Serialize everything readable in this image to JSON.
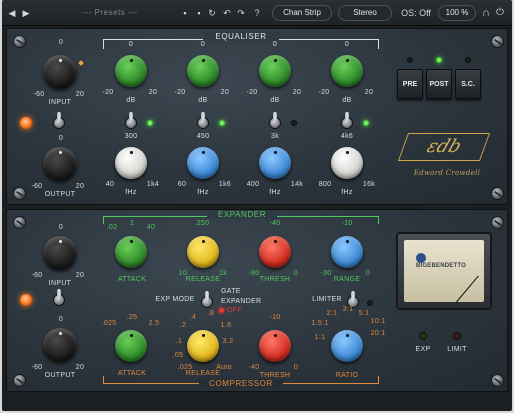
{
  "topbar": {
    "presets_label": "--- Presets ---",
    "chan_strip_label": "Chan Strip",
    "stereo_label": "Stereo",
    "os_label": "OS: Off",
    "zoom_label": "100 %",
    "help_label": "?"
  },
  "eq": {
    "title": "EQUALISER",
    "bands": [
      {
        "gain_top": "0",
        "gain_min": "-20",
        "gain_max": "20",
        "gain_unit": "dB",
        "freq_top": "300",
        "freq_min": "40",
        "freq_max": "1k4",
        "freq_unit": "fHz"
      },
      {
        "gain_top": "0",
        "gain_min": "-20",
        "gain_max": "20",
        "gain_unit": "dB",
        "freq_top": "450",
        "freq_min": "60",
        "freq_max": "1k6",
        "freq_unit": "fHz"
      },
      {
        "gain_top": "0",
        "gain_min": "-20",
        "gain_max": "20",
        "gain_unit": "dB",
        "freq_top": "3k",
        "freq_min": "400",
        "freq_max": "14k",
        "freq_unit": "fHz"
      },
      {
        "gain_top": "0",
        "gain_min": "-20",
        "gain_max": "20",
        "gain_unit": "dB",
        "freq_top": "4k6",
        "freq_min": "800",
        "freq_max": "16k",
        "freq_unit": "fHz"
      }
    ],
    "input": {
      "label": "INPUT",
      "top": "0",
      "min": "-60",
      "max": "20"
    },
    "output": {
      "label": "OUTPUT",
      "top": "0",
      "min": "-60",
      "max": "20"
    },
    "pre_label": "PRE",
    "post_label": "POST",
    "sc_label": "S.C.",
    "logo_text": "εdb",
    "signature_text": "Edward Crowdell"
  },
  "expander": {
    "title": "EXPANDER",
    "attack": {
      "label": "ATTACK",
      "t1": ".02",
      "t2": "2",
      "t3": "40"
    },
    "release": {
      "label": "RELEASE",
      "top": "250",
      "min": "10",
      "max": "1k"
    },
    "thresh": {
      "label": "THRESH",
      "top": "-40",
      "min": "-80",
      "max": "0"
    },
    "range": {
      "label": "RANGE",
      "top": "-10",
      "min": "-30",
      "max": "0"
    },
    "input": {
      "label": "INPUT",
      "top": "0",
      "min": "-60",
      "max": "20"
    },
    "output": {
      "label": "OUTPUT",
      "top": "0",
      "min": "-60",
      "max": "20"
    },
    "exp_mode_label": "EXP MODE",
    "gate_label": "GATE",
    "exp_option_label": "EXPANDER",
    "off_label": "OFF",
    "limiter_label": "LIMITER"
  },
  "compressor": {
    "title": "COMPRESSOR",
    "attack": {
      "label": "ATTACK",
      "t1": ".025",
      "t2": ".25",
      "t3": "2.5"
    },
    "release": {
      "label": "RELEASE",
      "t1": ".4",
      "t2": ".8",
      "t3": ".2",
      "t4": "1.6",
      "t5": ".1",
      "t6": "3.2",
      "t7": ".05",
      "t8": ".025",
      "t9": "Auto"
    },
    "thresh": {
      "label": "THRESH",
      "top": "-10",
      "min": "-40",
      "max": "0"
    },
    "ratio": {
      "label": "RATIO",
      "t1": "2:1",
      "t2": "3:1",
      "t3": "5:1",
      "t4": "10:1",
      "t5": "1.5:1",
      "t6": "20:1",
      "t7": "1:1"
    }
  },
  "meter": {
    "brand": "BIGEBENDETTO"
  },
  "indicators": {
    "exp_label": "EXP",
    "limit_label": "LIMIT"
  }
}
